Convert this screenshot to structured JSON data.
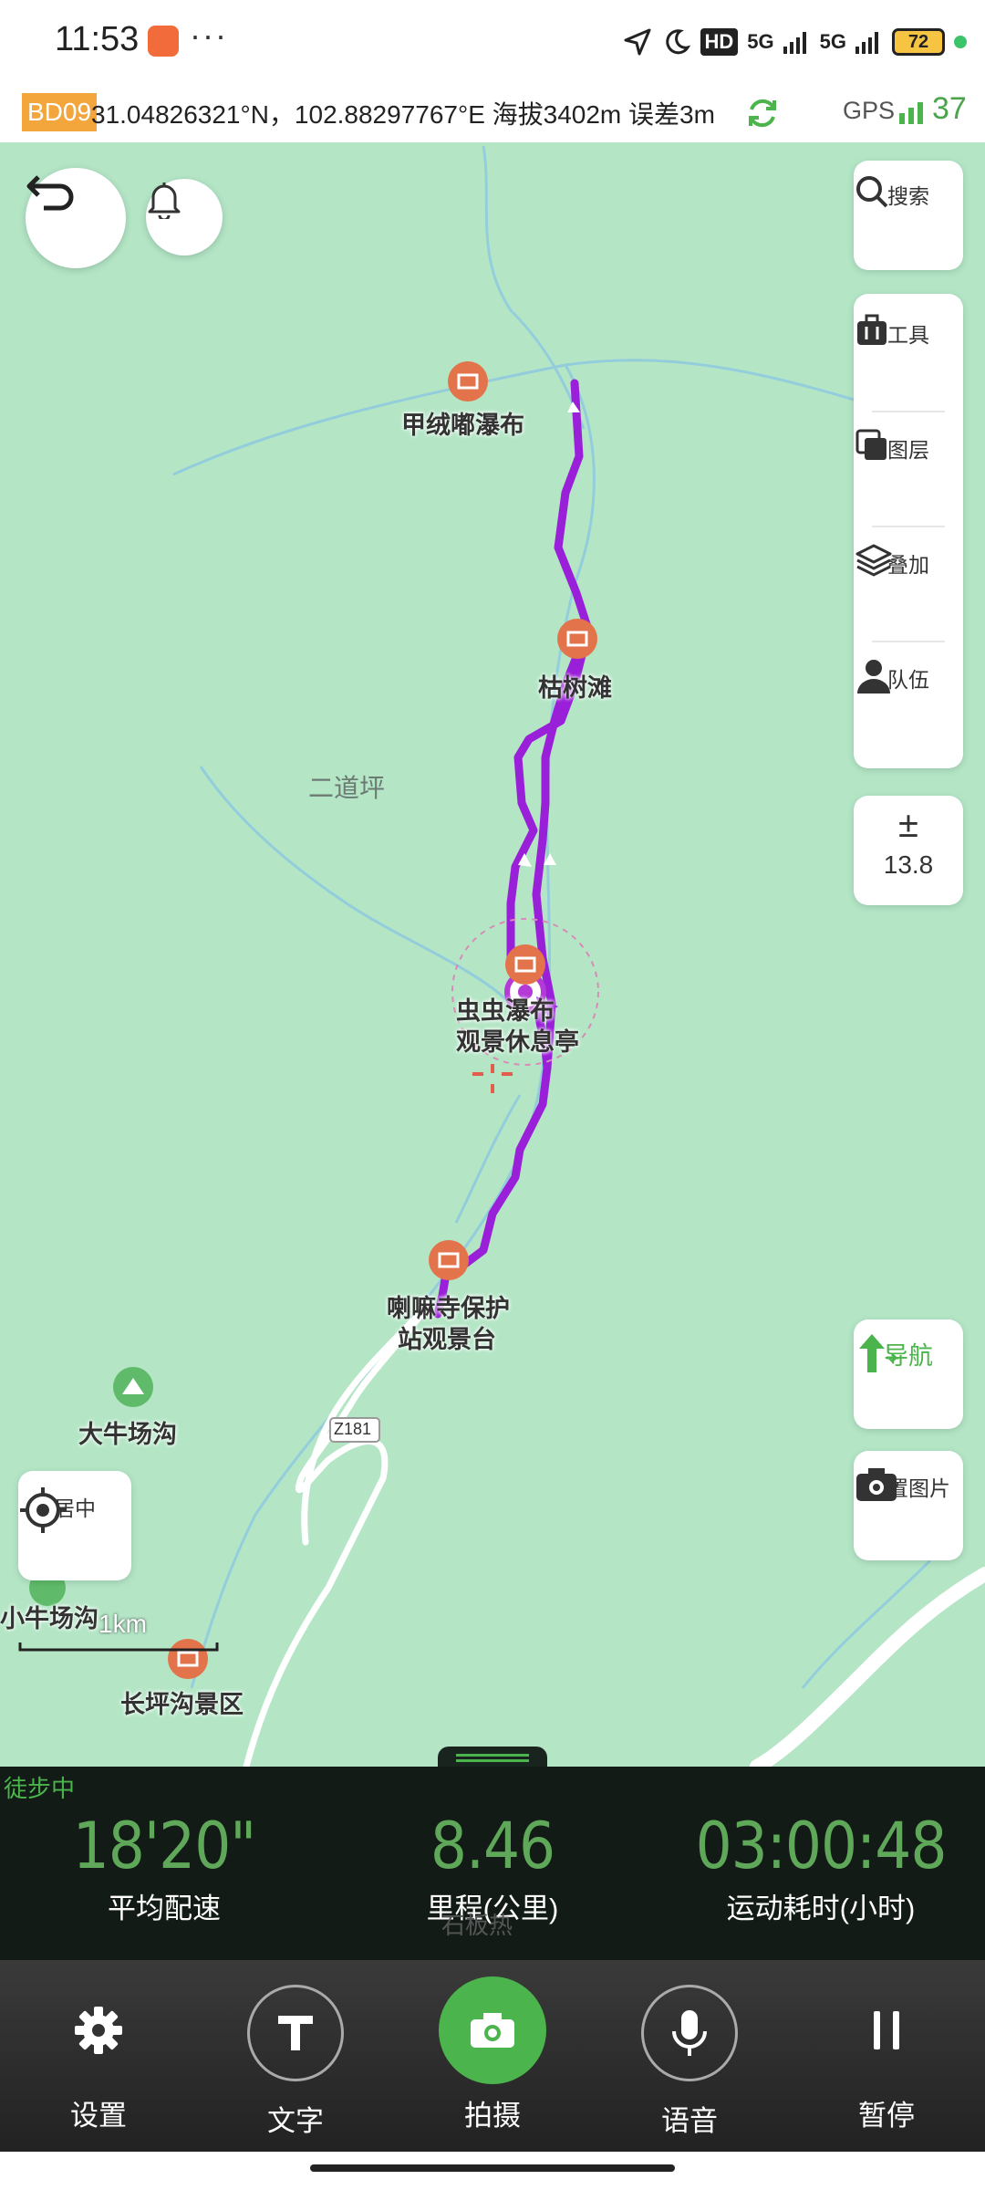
{
  "status_bar": {
    "time": "11:53",
    "more": "···",
    "net1": "HD",
    "net2": "5G",
    "net3": "5G",
    "battery": "72"
  },
  "coord_bar": {
    "datum": "BD09",
    "text": "31.04826321°N，102.88297767°E 海拔3402m 误差3m",
    "gps_label": "GPS",
    "gps_count": "37"
  },
  "map": {
    "pois": [
      {
        "name": "甲绒嘟瀑布"
      },
      {
        "name": "枯树滩"
      },
      {
        "name": "虫虫瀑布"
      },
      {
        "name": "观景休息亭"
      },
      {
        "name": "喇嘛寺保护"
      },
      {
        "name": "站观景台"
      },
      {
        "name": "大牛场沟"
      },
      {
        "name": "小牛场沟"
      },
      {
        "name": "长坪沟景区"
      }
    ],
    "area_label": "二道坪",
    "road_tag": "Z181",
    "scale": "1km",
    "hidden_label": "石板热"
  },
  "right_tools": {
    "search": "搜索",
    "tools": "工具",
    "layers": "图层",
    "overlay": "叠加",
    "team": "队伍",
    "zoom_symbol": "±",
    "zoom_level": "13.8",
    "navigate": "导航",
    "location_photo": "位置图片"
  },
  "center_button": "居中",
  "stats": {
    "mode": "徒步中",
    "pace_value": "18'20\"",
    "pace_label": "平均配速",
    "distance_value": "8.46",
    "distance_label": "里程(公里)",
    "time_value": "03:00:48",
    "time_label": "运动耗时(小时)"
  },
  "bottom_bar": {
    "settings": "设置",
    "text": "文字",
    "shoot": "拍摄",
    "voice": "语音",
    "pause": "暂停"
  },
  "colors": {
    "map_bg": "#b4e6c6",
    "track": "#9a1fd8",
    "accent_green": "#4cb44c",
    "poi_orange": "#e2734a"
  }
}
